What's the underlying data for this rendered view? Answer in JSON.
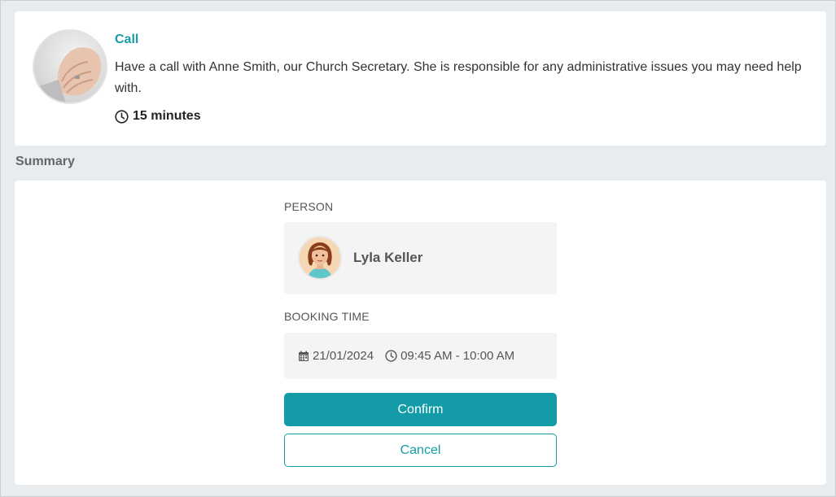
{
  "event": {
    "title": "Call",
    "description": "Have a call with Anne Smith, our Church Secretary. She is responsible for any administrative issues you may need help with.",
    "duration": "15 minutes"
  },
  "summary": {
    "heading": "Summary",
    "person_label": "PERSON",
    "person_name": "Lyla Keller",
    "booking_time_label": "BOOKING TIME",
    "date": "21/01/2024",
    "time_range": "09:45 AM - 10:00 AM"
  },
  "actions": {
    "confirm_label": "Confirm",
    "cancel_label": "Cancel"
  },
  "colors": {
    "accent": "#139ca8",
    "background": "#e9ecee",
    "card": "#ffffff",
    "info_box": "#f4f4f4"
  },
  "icons": {
    "duration": "clock-icon",
    "date": "calendar-icon",
    "time": "clock-icon"
  }
}
